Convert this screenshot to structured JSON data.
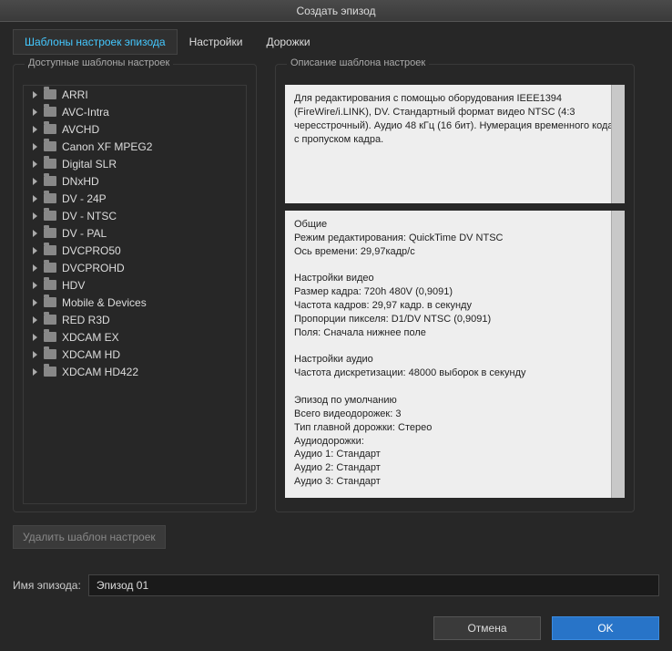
{
  "window": {
    "title": "Создать эпизод"
  },
  "tabs": [
    {
      "label": "Шаблоны настроек эпизода",
      "active": true
    },
    {
      "label": "Настройки",
      "active": false
    },
    {
      "label": "Дорожки",
      "active": false
    }
  ],
  "left_panel": {
    "title": "Доступные шаблоны настроек",
    "items": [
      "ARRI",
      "AVC-Intra",
      "AVCHD",
      "Canon XF MPEG2",
      "Digital SLR",
      "DNxHD",
      "DV - 24P",
      "DV - NTSC",
      "DV - PAL",
      "DVCPRO50",
      "DVCPROHD",
      "HDV",
      "Mobile & Devices",
      "RED R3D",
      "XDCAM EX",
      "XDCAM HD",
      "XDCAM HD422"
    ]
  },
  "right_panel": {
    "title": "Описание шаблона настроек",
    "description": "Для редактирования с помощью оборудования IEEE1394 (FireWire/i.LINK), DV. Стандартный формат видео NTSC (4:3 чересстрочный). Аудио 48 кГц (16 бит). Нумерация временного кода с пропуском кадра.",
    "details": "Общие\n Режим редактирования: QuickTime DV NTSC\n Ось времени: 29,97кадр/с\n\nНастройки видео\n Размер кадра: 720h 480V (0,9091)\n Частота кадров: 29,97 кадр. в секунду\n Пропорции пикселя: D1/DV NTSC (0,9091)\n Поля: Сначала нижнее поле\n\nНастройки аудио\n Частота дискретизации: 48000 выборок в секунду\n\nЭпизод по умолчанию\n Всего видеодорожек: 3\n Тип главной дорожки: Стерео\n Аудиодорожки:\n Аудио 1: Стандарт\n Аудио 2: Стандарт\n Аудио 3: Стандарт"
  },
  "buttons": {
    "delete_preset": "Удалить шаблон настроек",
    "cancel": "Отмена",
    "ok": "OK"
  },
  "name_field": {
    "label": "Имя эпизода:",
    "value": "Эпизод 01"
  }
}
